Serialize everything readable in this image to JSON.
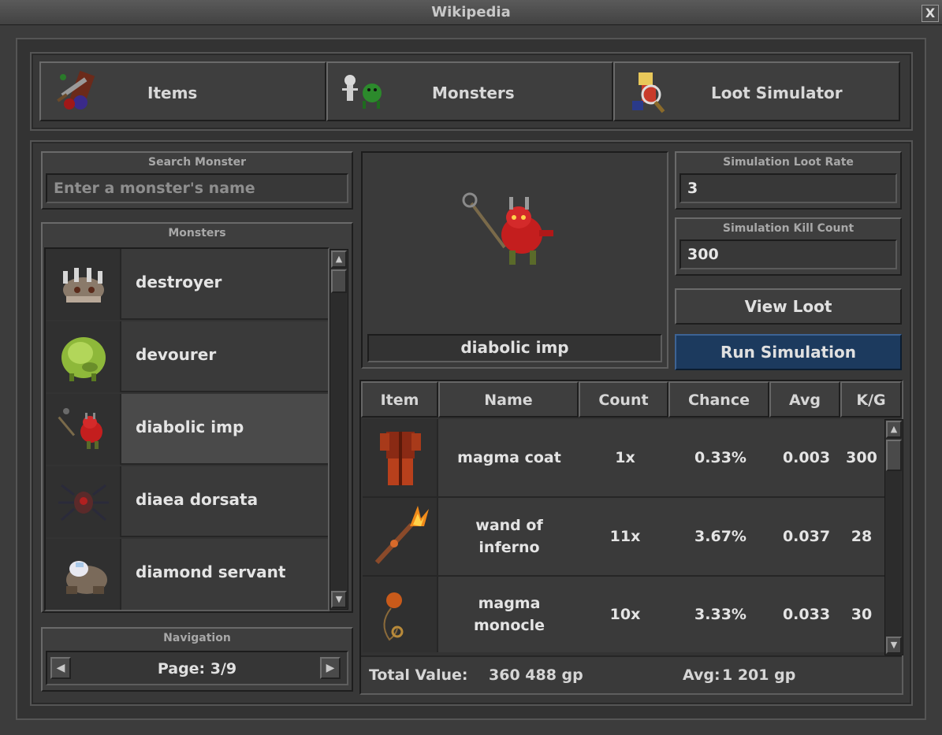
{
  "window": {
    "title": "Wikipedia",
    "close_glyph": "X"
  },
  "tabs": [
    {
      "label": "Items",
      "icon": "items-icon"
    },
    {
      "label": "Monsters",
      "icon": "monsters-icon"
    },
    {
      "label": "Loot Simulator",
      "icon": "loot-simulator-icon"
    }
  ],
  "search": {
    "title": "Search Monster",
    "placeholder": "Enter a monster's name",
    "value": ""
  },
  "monsters": {
    "title": "Monsters",
    "items": [
      {
        "name": "destroyer",
        "icon": "destroyer-icon",
        "selected": false
      },
      {
        "name": "devourer",
        "icon": "devourer-icon",
        "selected": false
      },
      {
        "name": "diabolic imp",
        "icon": "diabolic-imp-icon",
        "selected": true
      },
      {
        "name": "diaea dorsata",
        "icon": "diaea-dorsata-icon",
        "selected": false
      },
      {
        "name": "diamond servant",
        "icon": "diamond-servant-icon",
        "selected": false
      }
    ]
  },
  "navigation": {
    "title": "Navigation",
    "page_label": "Page: 3/9"
  },
  "preview": {
    "monster_name": "diabolic imp",
    "icon": "diabolic-imp-icon"
  },
  "simulation": {
    "loot_rate_title": "Simulation Loot Rate",
    "loot_rate_value": "3",
    "kill_count_title": "Simulation Kill Count",
    "kill_count_value": "300",
    "view_loot_label": "View Loot",
    "run_label": "Run Simulation"
  },
  "loot_table": {
    "headers": [
      "Item",
      "Name",
      "Count",
      "Chance",
      "Avg",
      "K/G"
    ],
    "rows": [
      {
        "icon": "magma-coat-icon",
        "name": "magma coat",
        "count": "1x",
        "chance": "0.33%",
        "avg": "0.003",
        "kg": "300"
      },
      {
        "icon": "wand-of-inferno-icon",
        "name": "wand of inferno",
        "count": "11x",
        "chance": "3.67%",
        "avg": "0.037",
        "kg": "28"
      },
      {
        "icon": "magma-monocle-icon",
        "name": "magma monocle",
        "count": "10x",
        "chance": "3.33%",
        "avg": "0.033",
        "kg": "30"
      }
    ]
  },
  "summary": {
    "total_label": "Total Value:",
    "total_value": "360 488 gp",
    "avg_label": "Avg:",
    "avg_value": "1 201 gp"
  },
  "colors": {
    "accent_button": "#1c3a5e",
    "background": "#3c3c3c",
    "selected_row": "#4a4a4a"
  }
}
